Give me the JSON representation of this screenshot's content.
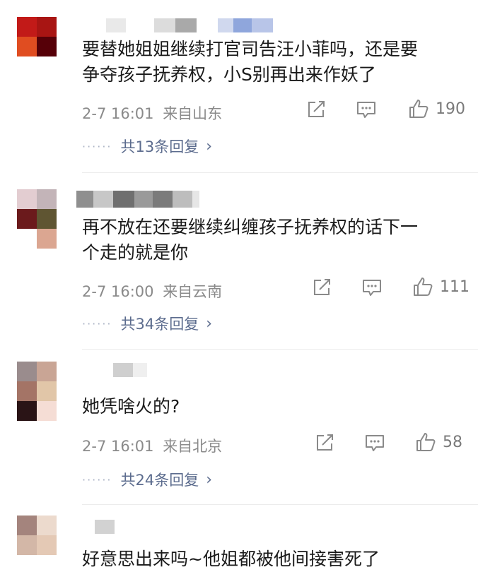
{
  "comments": [
    {
      "text_lines": [
        "要替她姐姐继续打官司告汪小菲吗，还是要",
        "争夺孩子抚养权，小S别再出来作妖了"
      ],
      "time": "2-7 16:01",
      "location": "来自山东",
      "likes": "190",
      "replies": "共13条回复",
      "avatar_colors": [
        "#c21a18",
        "#a81513",
        "#e04d21",
        "#560008"
      ]
    },
    {
      "text_lines": [
        "再不放在还要继续纠缠孩子抚养权的话下一",
        "个走的就是你"
      ],
      "time": "2-7 16:00",
      "location": "来自云南",
      "likes": "111",
      "replies": "共34条回复",
      "avatar_colors": [
        "#e3cdd1",
        "#c3b4b8",
        "#6b1a1c",
        "#5f5532",
        "#ffffff",
        "#dba691"
      ]
    },
    {
      "text_lines": [
        "她凭啥火的?"
      ],
      "time": "2-7 16:01",
      "location": "来自北京",
      "likes": "58",
      "replies": "共24条回复",
      "avatar_colors": [
        "#9a8c8d",
        "#c9a595",
        "#a47466",
        "#e1c6a8",
        "#2a1416",
        "#f5ddd5"
      ]
    },
    {
      "text_lines": [
        "好意思出来吗~他姐都被他间接害死了"
      ],
      "avatar_colors": [
        "#a4847d",
        "#ecdacd",
        "#d3b7a7",
        "#e4c9b5"
      ]
    }
  ],
  "icons": {
    "repost": "repost-icon",
    "comment": "comment-icon",
    "like": "thumbs-up-icon",
    "more": "chevron-right-icon"
  },
  "colors": {
    "text": "#1a1a1a",
    "meta": "#8a8a8a",
    "reply_link": "#5c6c8e",
    "divider": "#ececec"
  }
}
